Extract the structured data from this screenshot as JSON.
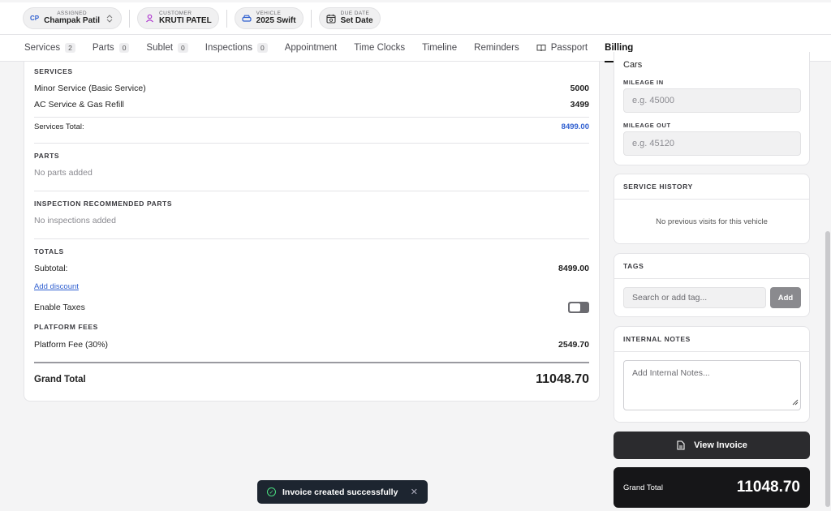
{
  "header": {
    "assigned": {
      "label": "ASSIGNED",
      "initials": "CP",
      "value": "Champak Patil"
    },
    "customer": {
      "label": "CUSTOMER",
      "value": "KRUTI PATEL"
    },
    "vehicle": {
      "label": "VEHICLE",
      "value": "2025 Swift"
    },
    "due_date": {
      "label": "DUE DATE",
      "value": "Set Date"
    }
  },
  "tabs": [
    {
      "label": "Services",
      "count": "2"
    },
    {
      "label": "Parts",
      "count": "0"
    },
    {
      "label": "Sublet",
      "count": "0"
    },
    {
      "label": "Inspections",
      "count": "0"
    },
    {
      "label": "Appointment"
    },
    {
      "label": "Time Clocks"
    },
    {
      "label": "Timeline"
    },
    {
      "label": "Reminders"
    },
    {
      "label": "Passport"
    },
    {
      "label": "Billing"
    }
  ],
  "billing": {
    "services_title": "SERVICES",
    "services": [
      {
        "name": "Minor Service (Basic Service)",
        "amount": "5000"
      },
      {
        "name": "AC Service & Gas Refill",
        "amount": "3499"
      }
    ],
    "services_total_label": "Services Total:",
    "services_total": "8499.00",
    "parts_title": "PARTS",
    "parts_empty": "No parts added",
    "inspection_title": "INSPECTION RECOMMENDED PARTS",
    "inspection_empty": "No inspections added",
    "totals_title": "TOTALS",
    "subtotal_label": "Subtotal:",
    "subtotal": "8499.00",
    "add_discount": "Add discount",
    "enable_taxes": "Enable Taxes",
    "platform_title": "PLATFORM FEES",
    "platform_label": "Platform Fee (30%)",
    "platform_fee": "2549.70",
    "grand_total_label": "Grand Total",
    "grand_total": "11048.70"
  },
  "vehicle_card": {
    "partial_text": "Cars",
    "mileage_in_label": "MILEAGE IN",
    "mileage_in_placeholder": "e.g. 45000",
    "mileage_out_label": "MILEAGE OUT",
    "mileage_out_placeholder": "e.g. 45120"
  },
  "service_history": {
    "title": "SERVICE HISTORY",
    "empty": "No previous visits for this vehicle"
  },
  "tags": {
    "title": "TAGS",
    "placeholder": "Search or add tag...",
    "add_label": "Add"
  },
  "notes": {
    "title": "INTERNAL NOTES",
    "placeholder": "Add Internal Notes..."
  },
  "view_invoice_label": "View Invoice",
  "summary": {
    "label": "Grand Total",
    "value": "11048.70"
  },
  "toast": {
    "message": "Invoice created successfully"
  }
}
